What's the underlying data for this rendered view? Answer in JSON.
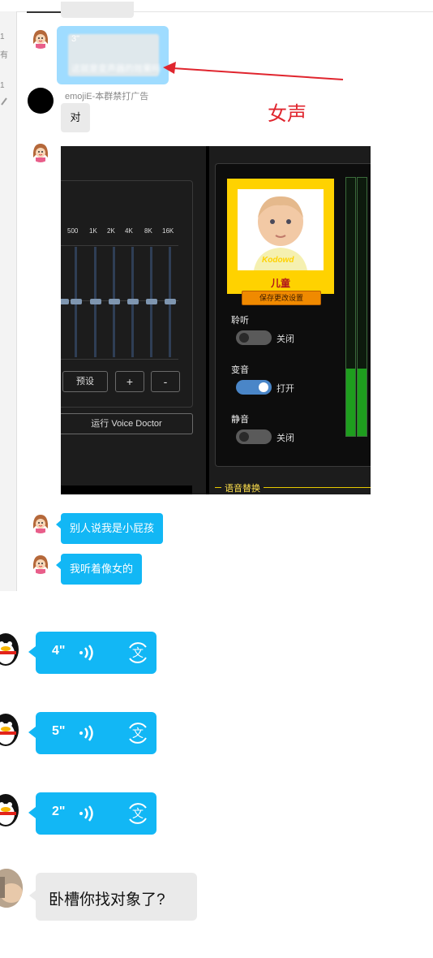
{
  "annotation": {
    "label": "女声",
    "color": "#e0252e"
  },
  "left_panel": {
    "numbers": [
      "1",
      "1"
    ],
    "chars": [
      "有"
    ]
  },
  "messages": [
    {
      "sender": "",
      "voice_duration": "3\"",
      "blurred_text": "这就是变声器的效果吗"
    },
    {
      "sender": "emojiE-本群禁打广告",
      "text": "对"
    },
    {
      "sender": "",
      "text": "别人说我是小屁孩"
    },
    {
      "sender": "",
      "text": "我听着像女的"
    }
  ],
  "voice_doctor": {
    "frequencies": [
      "500",
      "1K",
      "2K",
      "4K",
      "8K",
      "16K"
    ],
    "preset_button": "预设",
    "plus_button": "+",
    "minus_button": "-",
    "run_button": "运行 Voice Doctor",
    "character_name": "儿童",
    "photo_watermark": "Kodowd",
    "save_button": "保存更改设置",
    "listen_label": "聆听",
    "listen_state": "关闭",
    "change_label": "变音",
    "change_state": "打开",
    "mute_label": "静音",
    "mute_state": "关闭",
    "section_title": "语音替换",
    "meter_level": 0.26
  },
  "voice_messages": [
    {
      "duration": "4\""
    },
    {
      "duration": "5\""
    },
    {
      "duration": "2\""
    }
  ],
  "last_message": {
    "text": "卧槽你找对象了?"
  },
  "colors": {
    "bubble_blue": "#12b7f5",
    "bubble_gray": "#eaeaea",
    "vd_yellow": "#ffd200",
    "vd_toggle_on": "#4a86c8"
  }
}
